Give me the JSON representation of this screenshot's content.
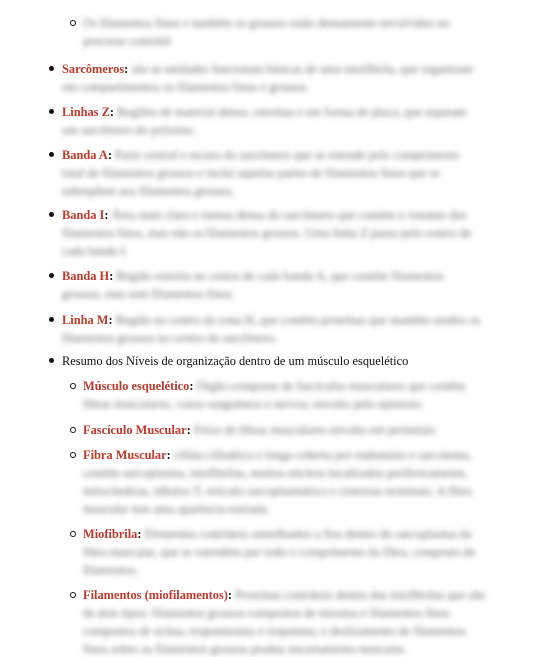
{
  "top_subitem": {
    "text": "Os filamentos finos e também os grossos estão densamente envolvidos no processo contrátil"
  },
  "items": [
    {
      "term": "Sarcômeros",
      "desc": "são as unidades funcionais básicas de uma miofibrila, que organizam em compartimentos os filamentos finos e grossos."
    },
    {
      "term": "Linhas Z",
      "desc": "Regiões de material denso, estreitas e em forma de placa, que separam um sarcômero do próximo."
    },
    {
      "term": "Banda A",
      "desc": "Parte central e escura do sarcômero que se estende pelo comprimento total de filamentos grossos e inclui aquelas partes de filamentos finos que se sobrepõem aos filamentos grossos."
    },
    {
      "term": "Banda I",
      "desc": "Área mais clara e menos densa do sarcômero que contém o restante dos filamentos finos, mas não os filamentos grossos. Uma linha Z passa pelo centro de cada banda I."
    },
    {
      "term": "Banda H",
      "desc": "Região estreita no centro de cada banda A, que contém filamentos grossos, mas sem filamentos finos."
    },
    {
      "term": "Linha M",
      "desc": "Região no centro da zona H, que contém proteínas que mantêm unidos os filamentos grossos no centro do sarcômero."
    }
  ],
  "summary": {
    "label": "Resumo dos Níveis de organização dentro de um músculo esquelético",
    "subitems": [
      {
        "term": "Músculo esquelético",
        "desc": "Órgão composto de fascículos musculares que contêm fibras musculares, vasos sanguíneos e nervos; envolto pelo epimísio."
      },
      {
        "term": "Fascículo Muscular",
        "desc": "Feixe de fibras musculares envolto em perimísio."
      },
      {
        "term": "Fibra Muscular",
        "desc": "célula cilíndrica e longa coberta por endomísio e sarcolema, contém sarcoplasma, miofibrilas, muitos núcleos localizados perifericamente, mitocôndrias, túbulos T, retículo sarcoplasmático e cisternas terminais. A fibra muscular tem uma aparência estriada."
      },
      {
        "term": "Miofibrila",
        "desc": "Elementos contráteis semelhantes a fios dentro do sarcoplasma da fibra muscular, que se estendem por todo o comprimento da fibra, composto de filamentos."
      },
      {
        "term": "Filamentos (miofilamentos)",
        "desc": "Proteínas contráteis dentro das miofibrilas que são de dois tipos: filamentos grossos compostos de miosina e filamentos finos compostos de actina, tropomiosina e troponina; o deslizamento de filamentos finos sobre os filamentos grossos produz encurtamento muscular."
      }
    ]
  },
  "colors": {
    "term": "#c0392b",
    "text": "#111111"
  }
}
